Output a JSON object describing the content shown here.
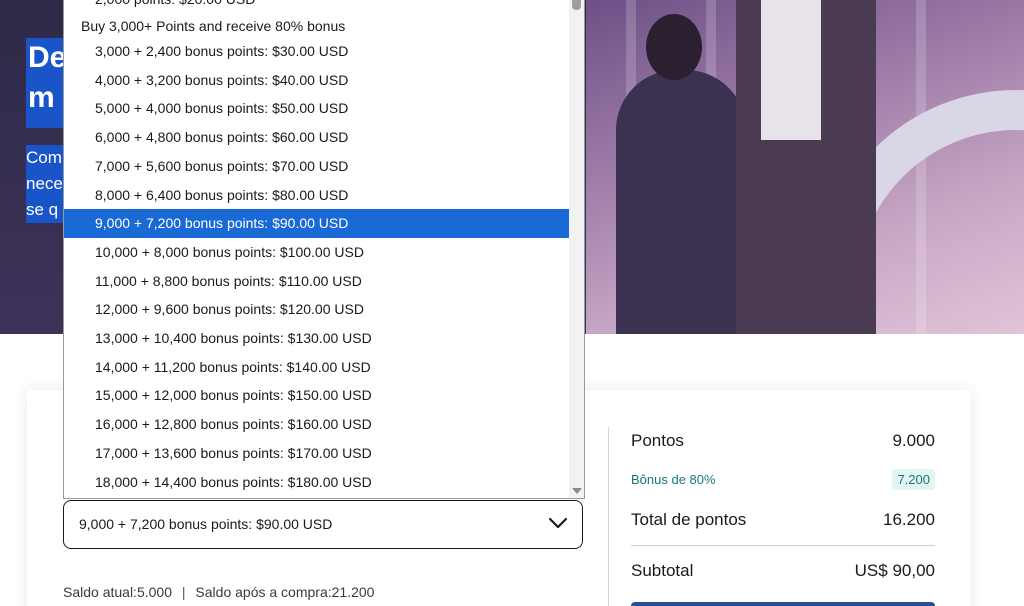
{
  "hero": {
    "title_lines": [
      "De",
      "m"
    ],
    "desc_lines": [
      "Com",
      "nece",
      "se q"
    ]
  },
  "dropdown": {
    "partial_top": "2,000 points: $20.00 USD",
    "group_label": "Buy 3,000+ Points and receive 80% bonus",
    "options": [
      "3,000 + 2,400 bonus points: $30.00 USD",
      "4,000 + 3,200 bonus points: $40.00 USD",
      "5,000 + 4,000 bonus points: $50.00 USD",
      "6,000 + 4,800 bonus points: $60.00 USD",
      "7,000 + 5,600 bonus points: $70.00 USD",
      "8,000 + 6,400 bonus points: $80.00 USD",
      "9,000 + 7,200 bonus points: $90.00 USD",
      "10,000 + 8,000 bonus points: $100.00 USD",
      "11,000 + 8,800 bonus points: $110.00 USD",
      "12,000 + 9,600 bonus points: $120.00 USD",
      "13,000 + 10,400 bonus points: $130.00 USD",
      "14,000 + 11,200 bonus points: $140.00 USD",
      "15,000 + 12,000 bonus points: $150.00 USD",
      "16,000 + 12,800 bonus points: $160.00 USD",
      "17,000 + 13,600 bonus points: $170.00 USD",
      "18,000 + 14,400 bonus points: $180.00 USD"
    ],
    "selected_index": 6
  },
  "select": {
    "value": "9,000 + 7,200 bonus points: $90.00 USD"
  },
  "balance": {
    "current_label": "Saldo atual:",
    "current_value": "5.000",
    "separator": "|",
    "after_label": "Saldo após a compra:",
    "after_value": "21.200"
  },
  "summary": {
    "pontos_label": "Pontos",
    "pontos_value": "9.000",
    "bonus_label": "Bônus de 80%",
    "bonus_value": "7.200",
    "total_label": "Total de pontos",
    "total_value": "16.200",
    "subtotal_label": "Subtotal",
    "subtotal_value": "US$ 90,00"
  },
  "colors": {
    "brand_blue": "#1955c8",
    "highlight": "#1a6ad6",
    "bonus_teal": "#14787a"
  }
}
